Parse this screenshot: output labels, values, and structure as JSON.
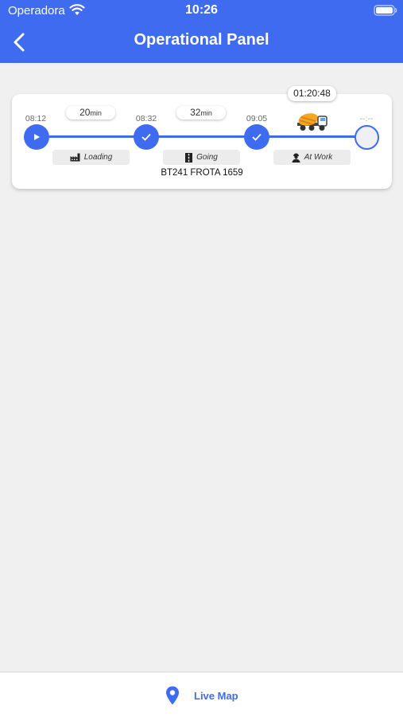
{
  "status_bar": {
    "carrier": "Operadora",
    "time": "10:26"
  },
  "header": {
    "title": "Operational Panel",
    "back_icon": "chevron-left-icon"
  },
  "trip": {
    "elapsed": "01:20:48",
    "times": [
      "08:12",
      "08:32",
      "09:05",
      "--:--"
    ],
    "durations": [
      {
        "value": "20",
        "unit": "min"
      },
      {
        "value": "32",
        "unit": "min"
      }
    ],
    "phases": [
      {
        "label": "Loading",
        "icon": "factory-icon"
      },
      {
        "label": "Going",
        "icon": "road-icon"
      },
      {
        "label": "At Work",
        "icon": "worker-icon"
      }
    ],
    "vehicle": "BT241 FROTA 1659",
    "current_icon": "concrete-mixer-truck-icon"
  },
  "footer": {
    "live_map_label": "Live Map",
    "icon": "location-pin-icon"
  },
  "colors": {
    "primary": "#3e6bf0",
    "background": "#f0f0f0"
  }
}
